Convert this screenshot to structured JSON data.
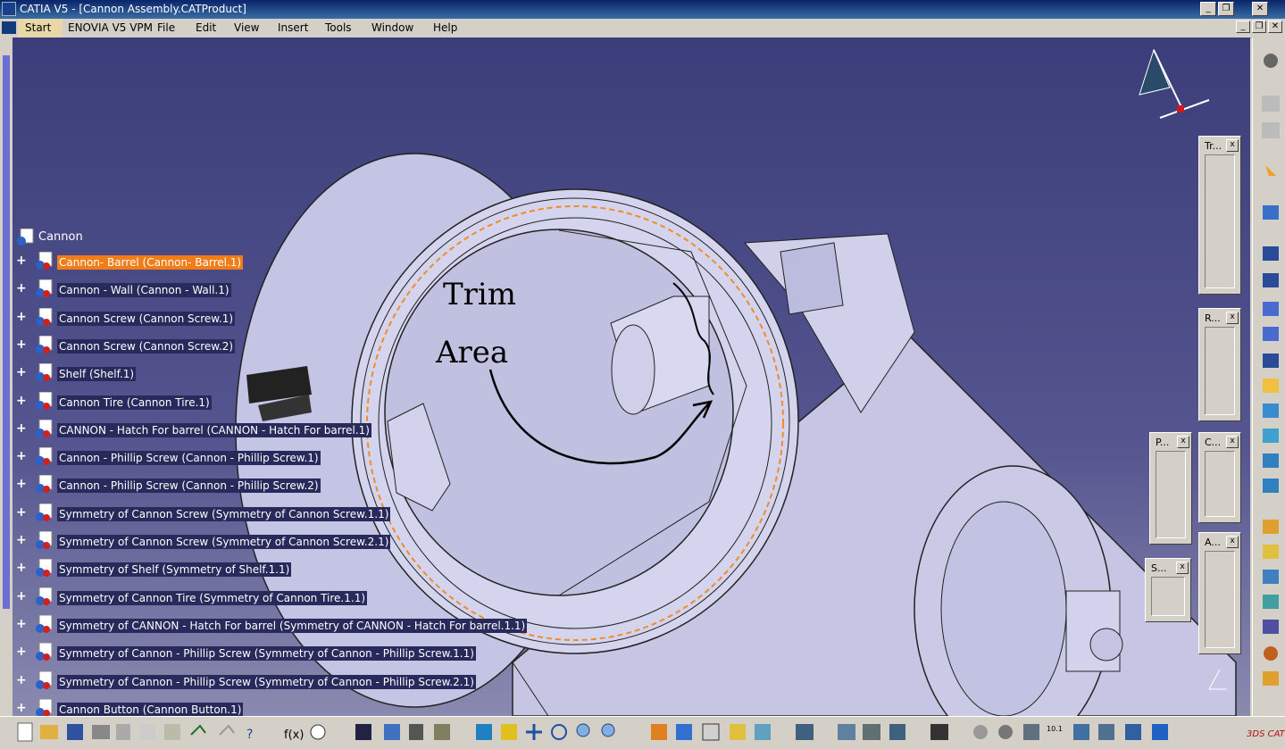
{
  "window": {
    "title": "CATIA V5 - [Cannon Assembly.CATProduct]",
    "minimize": "_",
    "restore": "❐",
    "close": "✕"
  },
  "menu": {
    "items": [
      "Start",
      "ENOVIA V5 VPM",
      "File",
      "Edit",
      "View",
      "Insert",
      "Tools",
      "Window",
      "Help"
    ]
  },
  "tree": {
    "root": "Cannon",
    "nodes": [
      "Cannon- Barrel (Cannon- Barrel.1)",
      "Cannon - Wall (Cannon - Wall.1)",
      "Cannon Screw (Cannon Screw.1)",
      "Cannon Screw (Cannon Screw.2)",
      "Shelf (Shelf.1)",
      "Cannon Tire (Cannon Tire.1)",
      "CANNON - Hatch For barrel (CANNON - Hatch For barrel.1)",
      "Cannon - Phillip Screw (Cannon - Phillip Screw.1)",
      "Cannon - Phillip Screw (Cannon - Phillip Screw.2)",
      "Symmetry of Cannon Screw (Symmetry of Cannon Screw.1.1)",
      "Symmetry of Cannon Screw (Symmetry of Cannon Screw.2.1)",
      "Symmetry of Shelf (Symmetry of Shelf.1.1)",
      "Symmetry of Cannon Tire (Symmetry of Cannon Tire.1.1)",
      "Symmetry of CANNON - Hatch For barrel (Symmetry of CANNON - Hatch For barrel.1.1)",
      "Symmetry of Cannon - Phillip Screw (Symmetry of Cannon - Phillip Screw.1.1)",
      "Symmetry of Cannon - Phillip Screw (Symmetry of Cannon - Phillip Screw.2.1)",
      "Cannon Button (Cannon Button.1)"
    ],
    "selected_index": 0
  },
  "annotation": {
    "line1": "Trim",
    "line2": "Area"
  },
  "floating_toolbars": {
    "tr": "Tr...",
    "r": "R...",
    "p": "P...",
    "c": "C...",
    "s": "S...",
    "a": "A..."
  },
  "colors": {
    "selected": "#f07d18",
    "tree_label_bg": "#272a5a",
    "viewport_top": "#3b3e7a",
    "part_fill": "#c8c8e6"
  }
}
